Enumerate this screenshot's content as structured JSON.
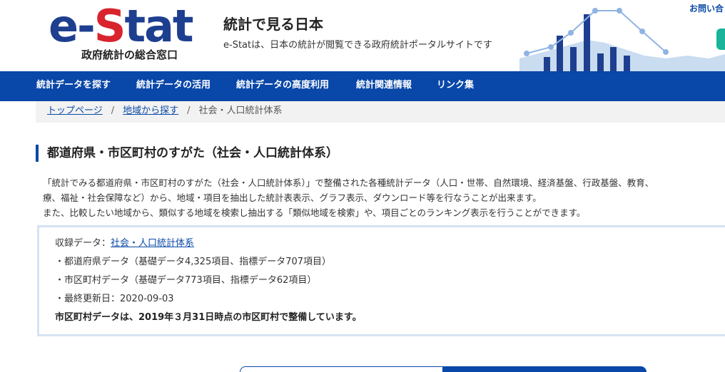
{
  "header": {
    "logo_text": "e-Stat",
    "logo_subtitle": "政府統計の総合窓口",
    "site_title": "統計で見る日本",
    "site_description": "e-Statは、日本の統計が閲覧できる政府統計ポータルサイトです",
    "contact_link": "お問い合",
    "colors": {
      "brand_blue": "#1e3f8f",
      "brand_red": "#d9232d",
      "nav_blue": "#0947a8",
      "accent_teal": "#19b49a"
    }
  },
  "nav": {
    "items": [
      {
        "label": "統計データを探す"
      },
      {
        "label": "統計データの活用"
      },
      {
        "label": "統計データの高度利用"
      },
      {
        "label": "統計関連情報"
      },
      {
        "label": "リンク集"
      }
    ]
  },
  "breadcrumb": {
    "items": [
      {
        "label": "トップページ"
      },
      {
        "label": "地域から探す"
      },
      {
        "label": "社会・人口統計体系"
      }
    ],
    "separator": "/"
  },
  "page": {
    "heading": "都道府県・市区町村のすがた（社会・人口統計体系）",
    "intro": [
      "「統計でみる都道府県・市区町村のすがた（社会・人口統計体系）」で整備された各種統計データ（人口・世帯、自然環境、経済基盤、行政基盤、教育、",
      "療、福祉・社会保障など）から、地域・項目を抽出した統計表表示、グラフ表示、ダウンロード等を行なうことが出来ます。",
      "また、比較したい地域から、類似する地域を検索し抽出する「類似地域を検索」や、項目ごとのランキング表示を行うことができます。"
    ]
  },
  "info_box": {
    "data_label": "収録データ：",
    "data_link": "社会・人口統計体系",
    "items": [
      "・都道府県データ（基礎データ4,325項目、指標データ707項目）",
      "・市区町村データ（基礎データ773項目、指標データ62項目）",
      "・最終更新日：2020-09-03"
    ],
    "note": "市区町村データは、2019年３月31日時点の市区町村で整備しています。"
  }
}
